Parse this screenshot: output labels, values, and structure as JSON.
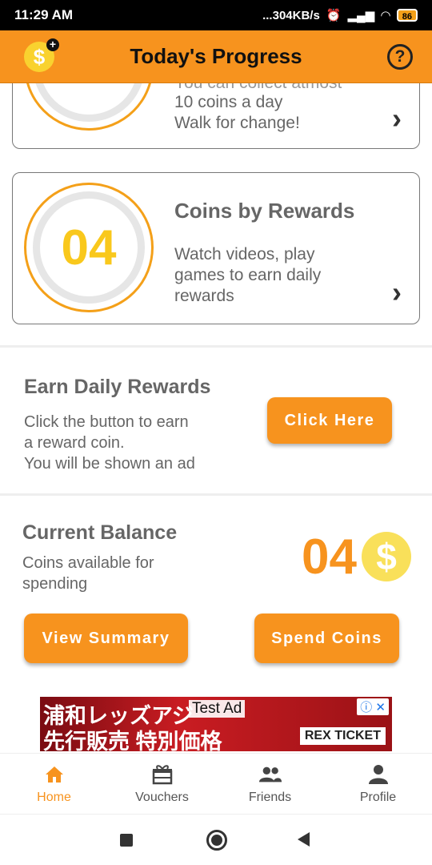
{
  "status_bar": {
    "time": "11:29 AM",
    "net_speed": "...304KB/s",
    "battery": "86"
  },
  "app_bar": {
    "title": "Today's Progress",
    "logo_symbol": "$",
    "plus_symbol": "+",
    "help_symbol": "?"
  },
  "walk_card": {
    "partial_line": "You can collect atmost",
    "lines": [
      "10 coins a day",
      "Walk for change!"
    ],
    "chevron": "›"
  },
  "rewards_card": {
    "value": "04",
    "title": "Coins by Rewards",
    "lines": [
      "Watch videos, play",
      "games to earn daily",
      "rewards"
    ],
    "chevron": "›"
  },
  "daily_rewards": {
    "title": "Earn Daily Rewards",
    "lines": [
      "Click the button to earn",
      "a reward coin.",
      "You will be shown an ad"
    ],
    "button_label": "Click Here"
  },
  "balance": {
    "title": "Current Balance",
    "lines": [
      "Coins available for",
      "spending"
    ],
    "value": "04",
    "coin_symbol": "$",
    "view_summary_label": "View Summary",
    "spend_coins_label": "Spend Coins"
  },
  "ad_banner": {
    "line1": "浦和レッズアジ",
    "line2": "先行販売 特別価格",
    "test_label": "Test Ad",
    "ticket_label": "REX TICKET",
    "close_label": "ⓘ ✕"
  },
  "bottom_nav": {
    "items": [
      {
        "label": "Home",
        "icon": "home-icon"
      },
      {
        "label": "Vouchers",
        "icon": "gift-icon"
      },
      {
        "label": "Friends",
        "icon": "group-icon"
      },
      {
        "label": "Profile",
        "icon": "person-icon"
      }
    ]
  },
  "colors": {
    "accent": "#f7931e",
    "coin_yellow": "#f9c81c"
  }
}
